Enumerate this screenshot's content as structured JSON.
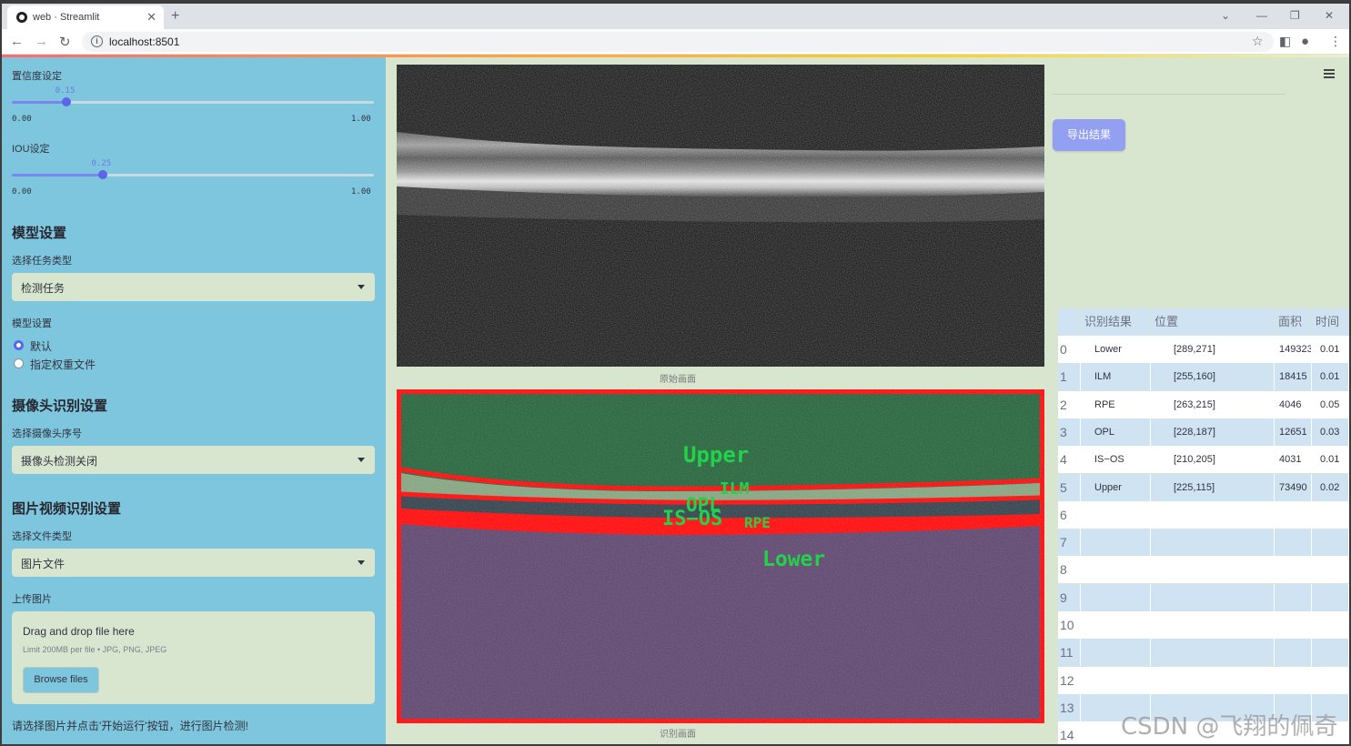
{
  "browser": {
    "tab_title": "web · Streamlit",
    "url": "localhost:8501"
  },
  "sidebar": {
    "confidence_label": "置信度设定",
    "confidence": {
      "value": "0.15",
      "min": "0.00",
      "max": "1.00",
      "fraction": 0.15
    },
    "iou_label": "IOU设定",
    "iou": {
      "value": "0.25",
      "min": "0.00",
      "max": "1.00",
      "fraction": 0.25
    },
    "model_section": "模型设置",
    "task_type_label": "选择任务类型",
    "task_type_value": "检测任务",
    "model_label": "模型设置",
    "model_options": [
      "默认",
      "指定权重文件"
    ],
    "camera_section": "摄像头识别设置",
    "camera_label": "选择摄像头序号",
    "camera_value": "摄像头检测关闭",
    "media_section": "图片视频识别设置",
    "file_type_label": "选择文件类型",
    "file_type_value": "图片文件",
    "upload_label": "上传图片",
    "upload_title": "Drag and drop file here",
    "upload_limit": "Limit 200MB per file • JPG, PNG, JPEG",
    "browse_button": "Browse files",
    "footer_hint": "请选择图片并点击'开始运行'按钮，进行图片检测!"
  },
  "main": {
    "orig_caption": "原始画面",
    "result_caption": "识别画面",
    "labels": [
      "Upper",
      "ILM",
      "OPL",
      "IS−OS",
      "RPE",
      "Lower"
    ],
    "export_button": "导出结果"
  },
  "table": {
    "headers": [
      "",
      "识别结果",
      "位置",
      "面积",
      "时间"
    ],
    "rows": [
      [
        "0",
        "Lower",
        "[289,271]",
        "149323",
        "0.01"
      ],
      [
        "1",
        "ILM",
        "[255,160]",
        "18415",
        "0.01"
      ],
      [
        "2",
        "RPE",
        "[263,215]",
        "4046",
        "0.05"
      ],
      [
        "3",
        "OPL",
        "[228,187]",
        "12651",
        "0.03"
      ],
      [
        "4",
        "IS−OS",
        "[210,205]",
        "4031",
        "0.01"
      ],
      [
        "5",
        "Upper",
        "[225,115]",
        "73490",
        "0.02"
      ],
      [
        "6",
        "",
        "",
        "",
        ""
      ],
      [
        "7",
        "",
        "",
        "",
        ""
      ],
      [
        "8",
        "",
        "",
        "",
        ""
      ],
      [
        "9",
        "",
        "",
        "",
        ""
      ],
      [
        "10",
        "",
        "",
        "",
        ""
      ],
      [
        "11",
        "",
        "",
        "",
        ""
      ],
      [
        "12",
        "",
        "",
        "",
        ""
      ],
      [
        "13",
        "",
        "",
        "",
        ""
      ],
      [
        "14",
        "",
        "",
        "",
        ""
      ]
    ]
  },
  "watermark": "CSDN @飞翔的佩奇",
  "colors": {
    "sidebar": "#7ec6dd",
    "main_bg": "#d9e6cf",
    "accent": "#5b66e8",
    "export_button": "#939ff0",
    "row_even": "#ffffff",
    "row_odd": "#cfe3f2"
  }
}
